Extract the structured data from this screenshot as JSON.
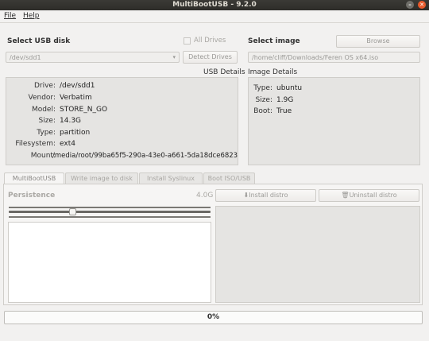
{
  "window": {
    "title": "MultiBootUSB - 9.2.0"
  },
  "menu": {
    "file": "File",
    "help": "Help"
  },
  "usb": {
    "section_title": "Select USB disk",
    "all_drives": "All Drives",
    "all_drives_checked": false,
    "selected_disk": "/dev/sdd1",
    "detect_button": "Detect Drives",
    "details_title": "USB Details",
    "details": [
      {
        "key": "Drive:",
        "value": "/dev/sdd1"
      },
      {
        "key": "Vendor:",
        "value": "Verbatim"
      },
      {
        "key": "Model:",
        "value": "STORE_N_GO"
      },
      {
        "key": "Size:",
        "value": "14.3G"
      },
      {
        "key": "Type:",
        "value": "partition"
      },
      {
        "key": "Filesystem:",
        "value": "ext4"
      },
      {
        "key": "Mount:",
        "value": "/media/root/99ba65f5-290a-43e0-a661-5da18dce6823"
      }
    ]
  },
  "image": {
    "section_title": "Select image",
    "browse_button": "Browse",
    "path": "/home/cliff/Downloads/Feren OS x64.iso",
    "details_title": "Image Details",
    "details": [
      {
        "key": "Type:",
        "value": "ubuntu"
      },
      {
        "key": "Size:",
        "value": "1.9G"
      },
      {
        "key": "Boot:",
        "value": "True"
      }
    ]
  },
  "tabs": [
    "MultiBootUSB",
    "Write image to disk",
    "Install Syslinux",
    "Boot ISO/USB"
  ],
  "active_tab": 0,
  "multiboot": {
    "persistence_label": "Persistence",
    "persistence_size": "4.0G",
    "persistence_fraction": 0.31,
    "install_button": "Install distro",
    "uninstall_button": "Uninstall distro"
  },
  "progress": {
    "value": 0,
    "label": "0%"
  },
  "colors": {
    "titlebar": "#2d2c29",
    "close_button": "#e85a2c"
  }
}
